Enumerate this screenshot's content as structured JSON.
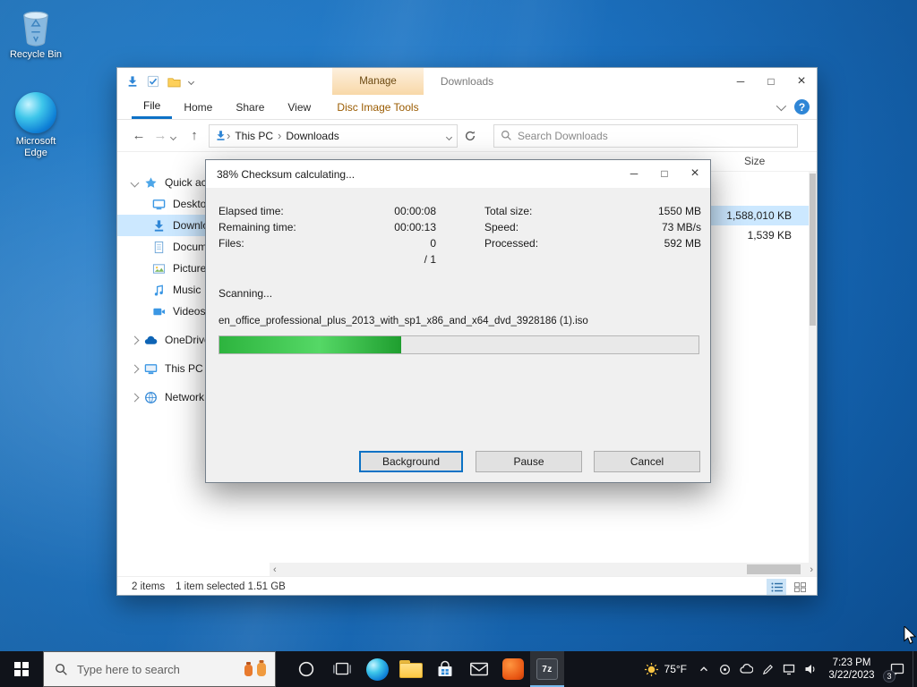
{
  "glyphs": {
    "minimize": "─",
    "maximize": "□",
    "close": "×",
    "back": "←",
    "forward": "→",
    "up": "↑",
    "breadcrumb_separator": "›",
    "hscroll_left": "‹",
    "hscroll_right": "›"
  },
  "desktop": {
    "icons": [
      {
        "label": "Recycle Bin"
      },
      {
        "label": "Microsoft Edge"
      }
    ]
  },
  "explorer": {
    "window_title": "Downloads",
    "contextual_group": "Manage",
    "tabs": {
      "file": "File",
      "home": "Home",
      "share": "Share",
      "view": "View",
      "contextual": "Disc Image Tools"
    },
    "breadcrumb": {
      "root": "This PC",
      "current": "Downloads"
    },
    "search_placeholder": "Search Downloads",
    "sidebar": {
      "items": [
        "Quick access",
        "Desktop",
        "Downloads",
        "Documents",
        "Pictures",
        "Music",
        "Videos",
        "OneDrive",
        "This PC",
        "Network"
      ]
    },
    "list": {
      "size_header": "Size",
      "rows": [
        {
          "size": "1,588,010 KB",
          "selected": true
        },
        {
          "size": "1,539 KB",
          "selected": false
        }
      ]
    },
    "statusbar": {
      "items_count": "2 items",
      "selection": "1 item selected 1.51 GB"
    }
  },
  "dialog": {
    "title": "38% Checksum calculating...",
    "stats_left": [
      {
        "label": "Elapsed time:",
        "value": "00:00:08"
      },
      {
        "label": "Remaining time:",
        "value": "00:00:13"
      },
      {
        "label": "Files:",
        "value": "0"
      },
      {
        "label": "",
        "value": "/ 1"
      }
    ],
    "stats_right": [
      {
        "label": "Total size:",
        "value": "1550 MB"
      },
      {
        "label": "Speed:",
        "value": "73 MB/s"
      },
      {
        "label": "Processed:",
        "value": "592 MB"
      }
    ],
    "scanning": "Scanning...",
    "filename": "en_office_professional_plus_2013_with_sp1_x86_and_x64_dvd_3928186 (1).iso",
    "progress_percent": 38,
    "buttons": {
      "background": "Background",
      "pause": "Pause",
      "cancel": "Cancel"
    }
  },
  "taskbar": {
    "search_placeholder": "Type here to search",
    "seven_zip_label": "7z",
    "weather_temp": "75°F",
    "clock_time": "7:23 PM",
    "clock_date": "3/22/2023",
    "notification_badge": "3"
  }
}
